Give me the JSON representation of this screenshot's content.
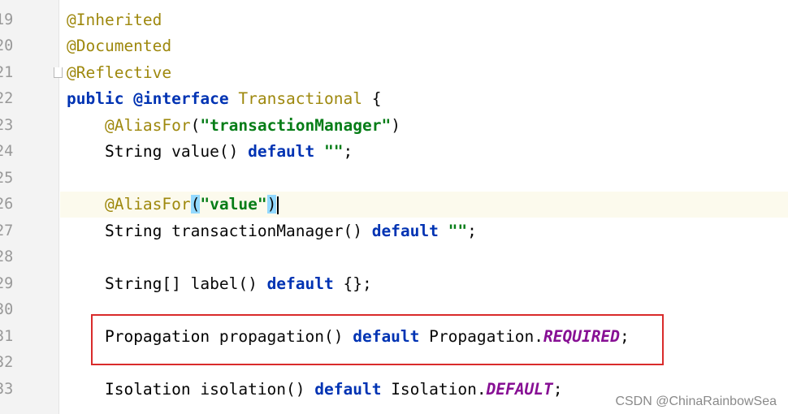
{
  "gutter": {
    "line_numbers": [
      "19",
      "20",
      "21",
      "22",
      "23",
      "24",
      "25",
      "26",
      "27",
      "28",
      "29",
      "30",
      "31",
      "32",
      "33"
    ]
  },
  "code": {
    "line_19": {
      "annotation": "@Inherited"
    },
    "line_20": {
      "annotation": "@Documented"
    },
    "line_21": {
      "annotation": "@Reflective"
    },
    "line_22": {
      "kw_public": "public",
      "kw_interface": "@interface",
      "name": "Transactional",
      "rest": " {"
    },
    "line_23": {
      "annotation": "@AliasFor",
      "open": "(",
      "string": "\"transactionManager\"",
      "close": ")"
    },
    "line_24": {
      "type": "String",
      "method": " value() ",
      "kw_default": "default",
      "string": " \"\"",
      "end": ";"
    },
    "line_26": {
      "annotation": "@AliasFor",
      "open": "(",
      "string": "\"value\"",
      "close": ")"
    },
    "line_27": {
      "type": "String",
      "method": " transactionManager() ",
      "kw_default": "default",
      "string": " \"\"",
      "end": ";"
    },
    "line_29": {
      "type": "String[]",
      "method": " label() ",
      "kw_default": "default",
      "rest": " {};"
    },
    "line_31": {
      "type": "Propagation",
      "method": " propagation() ",
      "kw_default": "default",
      "qualifier": " Propagation.",
      "constant": "REQUIRED",
      "end": ";"
    },
    "line_33": {
      "type": "Isolation",
      "method": " isolation() ",
      "kw_default": "default",
      "qualifier": " Isolation.",
      "constant": "DEFAULT",
      "end": ";"
    }
  },
  "watermark": "CSDN @ChinaRainbowSea",
  "colors": {
    "annotation": "#9e880d",
    "keyword": "#0033b3",
    "string": "#067d17",
    "constant": "#871094",
    "highlight_box": "#d92b2b",
    "current_line": "#fcfaed"
  }
}
